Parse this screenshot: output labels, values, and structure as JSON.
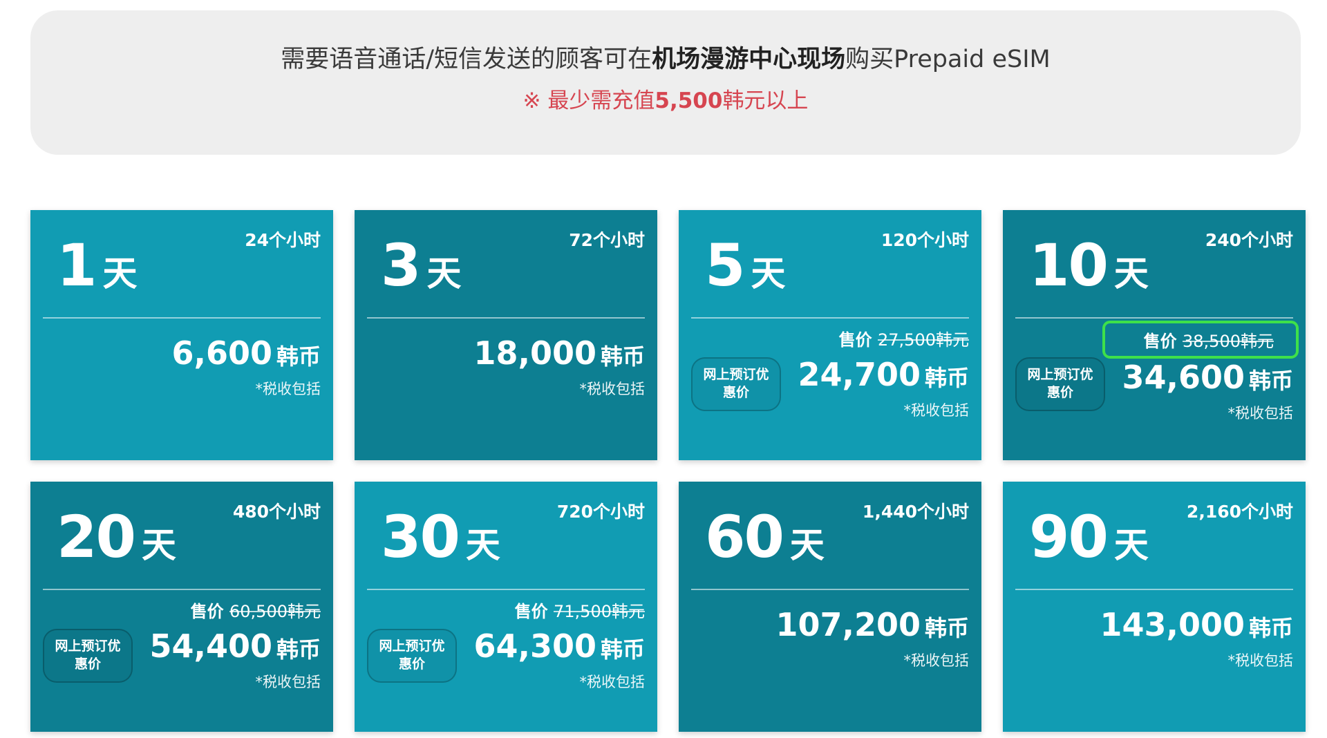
{
  "notice": {
    "line1_prefix": "需要语音通话/短信发送的顾客可在",
    "line1_bold": "机场漫游中心现场",
    "line1_suffix": "购买Prepaid eSIM",
    "line2_prefix": "※ 最少需充值",
    "line2_bold": "5,500",
    "line2_suffix": "韩元以上"
  },
  "labels": {
    "day_unit": "天",
    "currency": "韩币",
    "tax_note": "*税收包括",
    "orig_prefix": "售价",
    "badge": "网上预订优惠价"
  },
  "colors": {
    "card_light": "#119cb3",
    "card_dark": "#0d7f92",
    "notice_bg": "#eeeeee",
    "notice_red": "#d64550",
    "highlight_outline": "#3ee04a"
  },
  "plans": [
    {
      "days": "1",
      "hours": "24个小时",
      "price": "6,600",
      "original": "",
      "badge": false,
      "tone": "light"
    },
    {
      "days": "3",
      "hours": "72个小时",
      "price": "18,000",
      "original": "",
      "badge": false,
      "tone": "dark"
    },
    {
      "days": "5",
      "hours": "120个小时",
      "price": "24,700",
      "original": "27,500韩元",
      "badge": true,
      "tone": "light"
    },
    {
      "days": "10",
      "hours": "240个小时",
      "price": "34,600",
      "original": "38,500韩元",
      "badge": true,
      "tone": "dark",
      "highlighted": true
    },
    {
      "days": "20",
      "hours": "480个小时",
      "price": "54,400",
      "original": "60,500韩元",
      "badge": true,
      "tone": "dark"
    },
    {
      "days": "30",
      "hours": "720个小时",
      "price": "64,300",
      "original": "71,500韩元",
      "badge": true,
      "tone": "light"
    },
    {
      "days": "60",
      "hours": "1,440个小时",
      "price": "107,200",
      "original": "",
      "badge": false,
      "tone": "dark"
    },
    {
      "days": "90",
      "hours": "2,160个小时",
      "price": "143,000",
      "original": "",
      "badge": false,
      "tone": "light"
    }
  ]
}
